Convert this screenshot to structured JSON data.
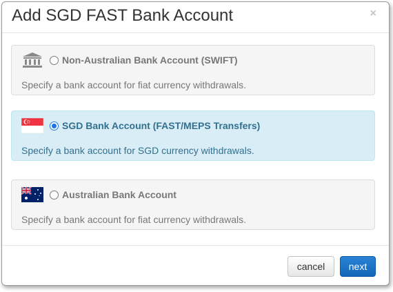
{
  "dialog": {
    "title": "Add SGD FAST Bank Account",
    "close_symbol": "×"
  },
  "options": [
    {
      "label": "Non-Australian Bank Account (SWIFT)",
      "description": "Specify a bank account for fiat currency withdrawals.",
      "icon": "bank-icon",
      "selected": false
    },
    {
      "label": "SGD Bank Account (FAST/MEPS Transfers)",
      "description": "Specify a bank account for SGD currency withdrawals.",
      "icon": "singapore-flag-icon",
      "selected": true
    },
    {
      "label": "Australian Bank Account",
      "description": "Specify a bank account for fiat currency withdrawals.",
      "icon": "australia-flag-icon",
      "selected": false
    }
  ],
  "footer": {
    "cancel_label": "cancel",
    "next_label": "next"
  },
  "colors": {
    "selected_bg": "#d9edf7",
    "selected_text": "#31708f",
    "primary_button": "#1a6fc4"
  }
}
